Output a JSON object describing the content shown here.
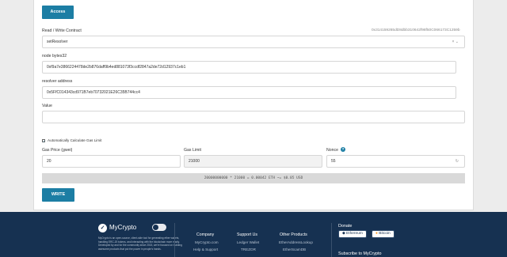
{
  "form": {
    "access_label": "Access",
    "contract_label": "Read / Write Contract",
    "contract_address": "0x314159265dD8dbb310642f98f50C066173C1259b",
    "function_selected": "setResolver",
    "node_label": "node bytes32",
    "node_value": "0xf9a7e3866224478de2b876daff9b4ed881073f3ccdf2847a2de72d12937c1eb1",
    "resolver_label": "resolver address",
    "resolver_value": "0x5FfC014343cd971B7eb70732021E26C35B744cc4",
    "value_label": "Value",
    "value_value": "",
    "auto_gas_label": "Automatically Calculate Gas Limit",
    "auto_gas_checked": true,
    "gas_price_label": "Gas Price (gwei)",
    "gas_price_value": "20",
    "gas_limit_label": "Gas Limit",
    "gas_limit_value": "21000",
    "nonce_label": "Nonce",
    "nonce_value": "55",
    "fee_summary": "20000000000 * 21000 = 0.00042 ETH ~= $0.05 USD",
    "write_label": "WRITE"
  },
  "footer": {
    "brand": "MyCrypto",
    "blurb": "MyCrypto is an open-source, client-side tool for generating ether wallets, handling ERC-20 tokens, and interacting with the blockchain more easily. Developed by and for the community since 2015, we're focused on building awesome products that put the power in people's hands.",
    "company": {
      "title": "Company",
      "links": [
        "MyCrypto.com",
        "Help & Support"
      ]
    },
    "support": {
      "title": "Support Us",
      "links": [
        "Ledger Wallet",
        "TREZOR"
      ]
    },
    "other": {
      "title": "Other Products",
      "links": [
        "EtherAddressLookup",
        "EtherScamDB"
      ]
    },
    "donate": {
      "title": "Donate",
      "ethereum": "Ethereum",
      "bitcoin": "Bitcoin"
    },
    "subscribe": "Subscribe to MyCrypto"
  },
  "colors": {
    "accent": "#1c7ea4",
    "footer_bg": "#163151"
  }
}
